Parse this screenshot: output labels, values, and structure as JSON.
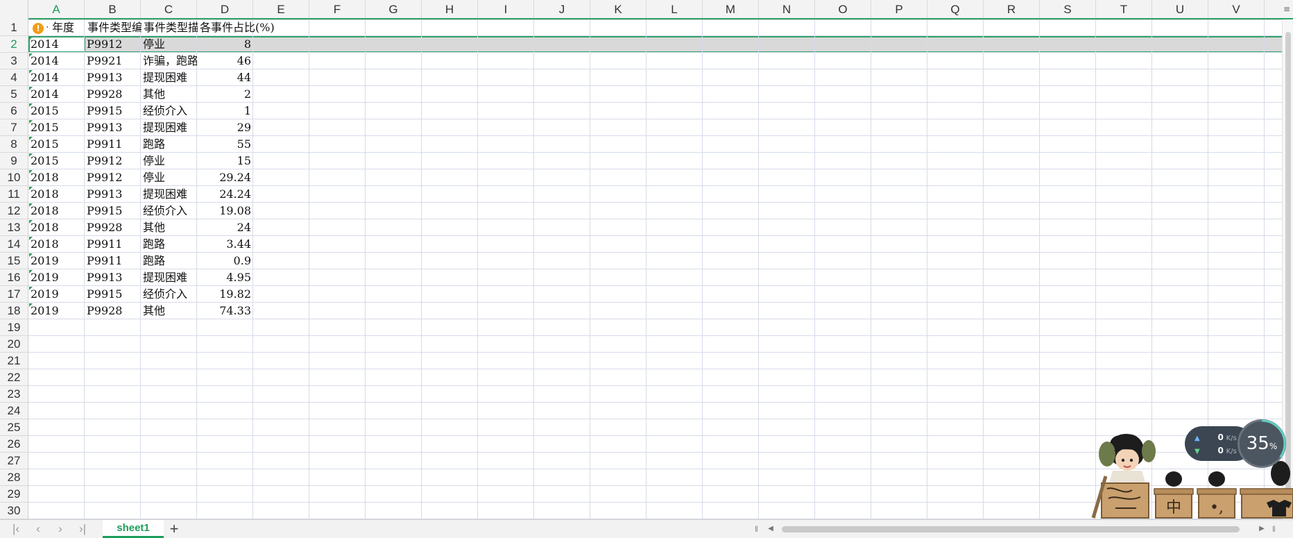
{
  "columns": [
    "A",
    "B",
    "C",
    "D",
    "E",
    "F",
    "G",
    "H",
    "I",
    "J",
    "K",
    "L",
    "M",
    "N",
    "O",
    "P",
    "Q",
    "R",
    "S",
    "T",
    "U",
    "V"
  ],
  "row_numbers": [
    "1",
    "2",
    "3",
    "4",
    "5",
    "6",
    "7",
    "8",
    "9",
    "10",
    "11",
    "12",
    "13",
    "14",
    "15",
    "16",
    "17",
    "18",
    "19",
    "20",
    "21",
    "22",
    "23",
    "24",
    "25",
    "26",
    "27",
    "28",
    "29",
    "30"
  ],
  "header_row": {
    "a": "年度",
    "b": "事件类型编码",
    "c": "事件类型描述",
    "d": "各事件占比(%)"
  },
  "rows": [
    {
      "a": "2014",
      "b": "P9912",
      "c": "停业",
      "d": "8"
    },
    {
      "a": "2014",
      "b": "P9921",
      "c": "诈骗，跑路",
      "d": "46"
    },
    {
      "a": "2014",
      "b": "P9913",
      "c": "提现困难",
      "d": "44"
    },
    {
      "a": "2014",
      "b": "P9928",
      "c": "其他",
      "d": "2"
    },
    {
      "a": "2015",
      "b": "P9915",
      "c": "经侦介入",
      "d": "1"
    },
    {
      "a": "2015",
      "b": "P9913",
      "c": "提现困难",
      "d": "29"
    },
    {
      "a": "2015",
      "b": "P9911",
      "c": "跑路",
      "d": "55"
    },
    {
      "a": "2015",
      "b": "P9912",
      "c": "停业",
      "d": "15"
    },
    {
      "a": "2018",
      "b": "P9912",
      "c": "停业",
      "d": "29.24"
    },
    {
      "a": "2018",
      "b": "P9913",
      "c": "提现困难",
      "d": "24.24"
    },
    {
      "a": "2018",
      "b": "P9915",
      "c": "经侦介入",
      "d": "19.08"
    },
    {
      "a": "2018",
      "b": "P9928",
      "c": "其他",
      "d": "24"
    },
    {
      "a": "2018",
      "b": "P9911",
      "c": "跑路",
      "d": "3.44"
    },
    {
      "a": "2019",
      "b": "P9911",
      "c": "跑路",
      "d": "0.9"
    },
    {
      "a": "2019",
      "b": "P9913",
      "c": "提现困难",
      "d": "4.95"
    },
    {
      "a": "2019",
      "b": "P9915",
      "c": "经侦介入",
      "d": "19.82"
    },
    {
      "a": "2019",
      "b": "P9928",
      "c": "其他",
      "d": "74.33"
    }
  ],
  "sheet_tabs": [
    {
      "label": "sheet1",
      "active": true
    }
  ],
  "nav": {
    "first": "|‹",
    "prev": "‹",
    "next": "›",
    "last": "›|",
    "add": "+"
  },
  "net_monitor": {
    "up_value": "0",
    "up_unit": "K/s",
    "down_value": "0",
    "down_unit": "K/s"
  },
  "cpu_monitor": {
    "value": "35",
    "unit": "%",
    "fraction": 0.35
  },
  "mascot": {
    "box_labels": [
      "中",
      "•,"
    ]
  },
  "colors": {
    "accent": "#1f9d5a",
    "selection": "#2fa36b",
    "grid": "#d6dbe8",
    "warning": "#f39c12"
  },
  "icons": {
    "warning": "warning-icon",
    "dropdown": "dropdown-arrow-icon"
  }
}
